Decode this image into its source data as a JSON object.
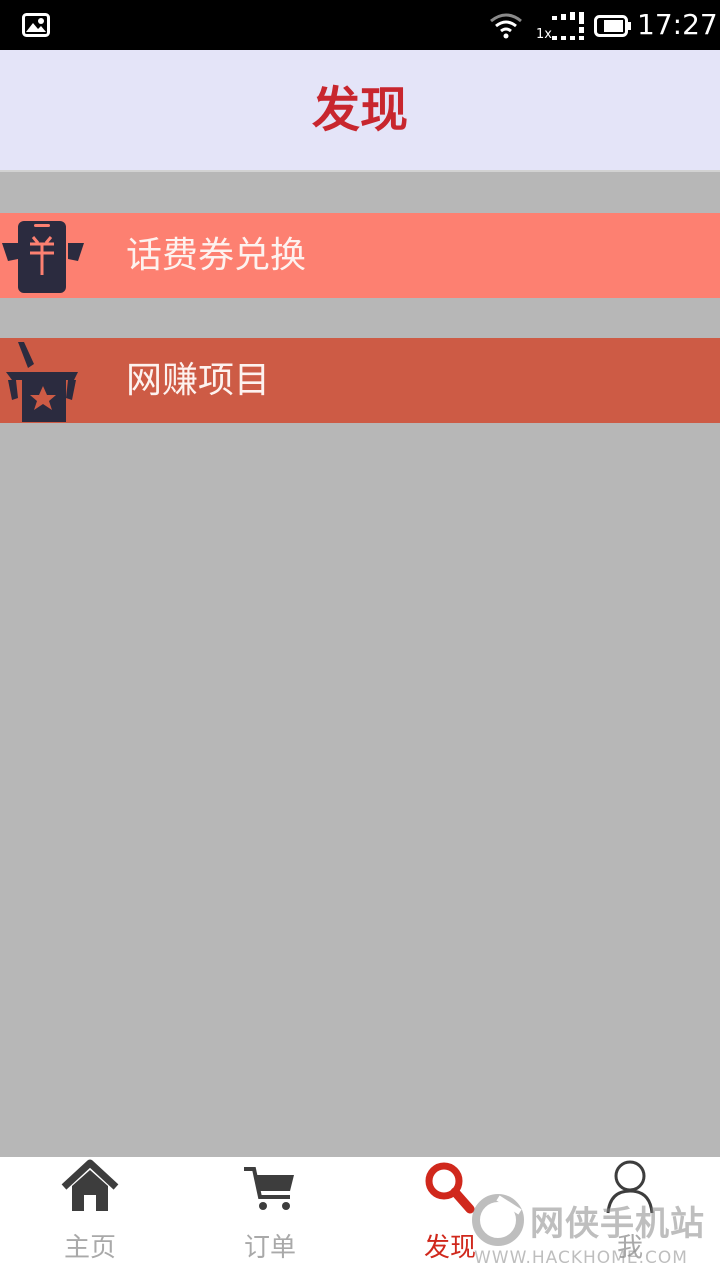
{
  "status_bar": {
    "time": "17:27",
    "network_label": "1x",
    "icons": [
      "gallery-icon",
      "wifi-icon",
      "signal-icon",
      "battery-icon"
    ]
  },
  "header": {
    "title": "发现"
  },
  "menu": [
    {
      "label": "话费券兑换",
      "icon": "phone-yuan-icon",
      "color": "#fd8071"
    },
    {
      "label": "网赚项目",
      "icon": "ice-bucket-star-icon",
      "color": "#cd5b45"
    }
  ],
  "bottom_nav": [
    {
      "label": "主页",
      "icon": "home-icon",
      "active": false
    },
    {
      "label": "订单",
      "icon": "cart-icon",
      "active": false
    },
    {
      "label": "发现",
      "icon": "search-icon",
      "active": true
    },
    {
      "label": "我",
      "icon": "person-icon",
      "active": false
    }
  ],
  "watermark": {
    "text": "网侠手机站",
    "url_text": "WWW.HACKHOME.COM"
  },
  "colors": {
    "title": "#c8262e",
    "header_bg": "#e4e4f8",
    "page_bg": "#b7b7b7",
    "nav_active": "#d0281c",
    "nav_inactive": "#a9a9a9",
    "icon_dark": "#2b2b3f"
  }
}
